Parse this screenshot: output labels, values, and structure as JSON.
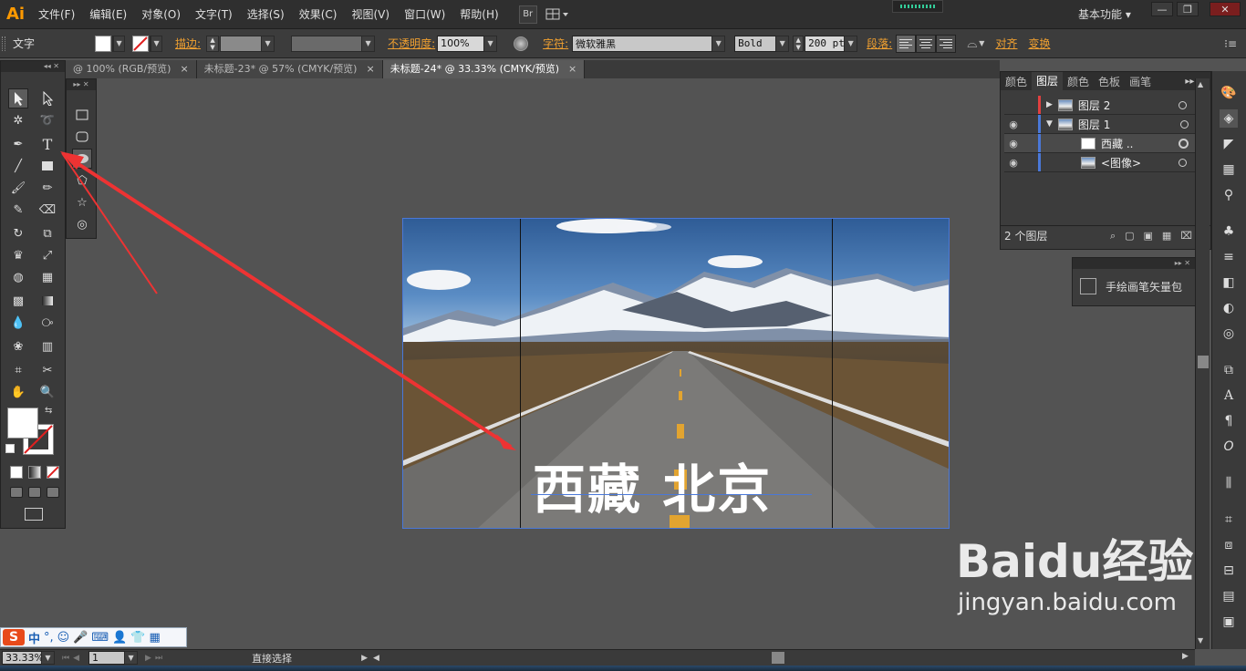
{
  "app": {
    "logo": "Ai"
  },
  "menu": [
    "文件(F)",
    "编辑(E)",
    "对象(O)",
    "文字(T)",
    "选择(S)",
    "效果(C)",
    "视图(V)",
    "窗口(W)",
    "帮助(H)"
  ],
  "menubar_buttons": {
    "bridge": "Br"
  },
  "workspace": "基本功能",
  "control": {
    "tool_name": "文字",
    "stroke_label": "描边:",
    "opacity_label": "不透明度:",
    "opacity_value": "100%",
    "char_label": "字符:",
    "font_family": "微软雅黑",
    "font_style": "Bold",
    "font_size": "200 pt",
    "para_label": "段落:",
    "align_label": "对齐",
    "transform_label": "变换"
  },
  "tabs": [
    {
      "label": "@ 100% (RGB/预览)"
    },
    {
      "label": "未标题-23* @ 57% (CMYK/预览)"
    },
    {
      "label": "未标题-24* @ 33.33% (CMYK/预览)"
    }
  ],
  "canvas": {
    "text": "西藏  北京"
  },
  "layers_panel": {
    "tabs": [
      "颜色",
      "图层",
      "颜色",
      "色板",
      "画笔"
    ],
    "rows": [
      {
        "name": "图层 2"
      },
      {
        "name": "图层 1"
      },
      {
        "name": "西藏 .."
      },
      {
        "name": "<图像>"
      }
    ],
    "count": "2 个图层"
  },
  "brush_panel": {
    "item": "手绘画笔矢量包"
  },
  "status": {
    "zoom": "33.33%",
    "page": "1",
    "tool": "直接选择"
  },
  "ime": {
    "mode": "中"
  },
  "watermark": {
    "brand_text": "Baidu经验",
    "url": "jingyan.baidu.com"
  },
  "colors": {
    "accent_orange": "#f0a030",
    "arrow_red": "#ee3333",
    "selection_blue": "#4a78d8"
  }
}
